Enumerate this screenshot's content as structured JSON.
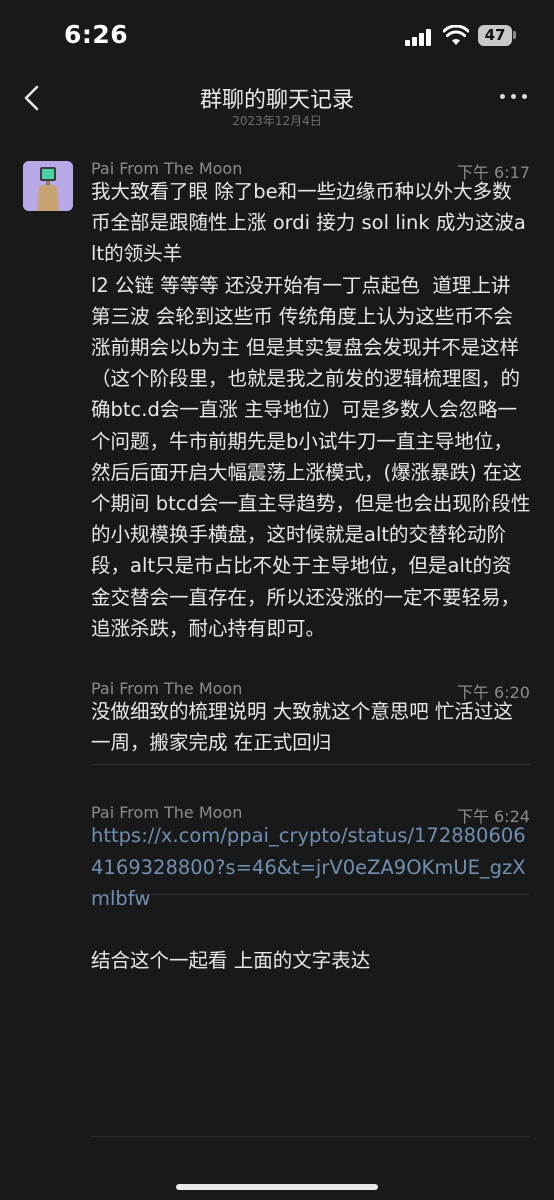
{
  "status_bar": {
    "time": "6:26",
    "battery": "47"
  },
  "nav": {
    "title": "群聊的聊天记录",
    "subtitle": "2023年12月4日"
  },
  "messages": [
    {
      "sender": "Pai From The Moon",
      "time": "下午 6:17",
      "text": "我大致看了眼 除了be和一些边缘币种以外大多数币全部是跟随性上涨 ordi 接力 sol link 成为这波alt的领头羊\nl2 公链 等等等 还没开始有一丁点起色  道理上讲 第三波 会轮到这些币 传统角度上认为这些币不会涨前期会以b为主 但是其实复盘会发现并不是这样（这个阶段里，也就是我之前发的逻辑梳理图，的确btc.d会一直涨 主导地位）可是多数人会忽略一个问题，牛市前期先是b小试牛刀一直主导地位，然后后面开启大幅震荡上涨模式，(爆涨暴跌) 在这个期间 btcd会一直主导趋势，但是也会出现阶段性的小规模换手横盘，这时候就是alt的交替轮动阶段，alt只是市占比不处于主导地位，但是alt的资金交替会一直存在，所以还没涨的一定不要轻易，追涨杀跌，耐心持有即可。"
    },
    {
      "sender": "Pai From The Moon",
      "time": "下午 6:20",
      "text": "没做细致的梳理说明 大致就这个意思吧 忙活过这一周，搬家完成 在正式回归"
    },
    {
      "sender": "Pai From The Moon",
      "time": "下午 6:24",
      "link": "https://x.com/ppai_crypto/status/1728806064169328800?s=46&t=jrV0eZA9OKmUE_gzXmlbfw",
      "text": "结合这个一起看 上面的文字表达"
    }
  ],
  "colors": {
    "background": "#191919",
    "link": "#6f8fb4",
    "meta": "#8b8b8b",
    "avatar_bg": "#b9a8e6"
  },
  "icons": [
    "back-chevron-icon",
    "more-dots-icon",
    "signal-icon",
    "wifi-icon",
    "battery-icon"
  ]
}
